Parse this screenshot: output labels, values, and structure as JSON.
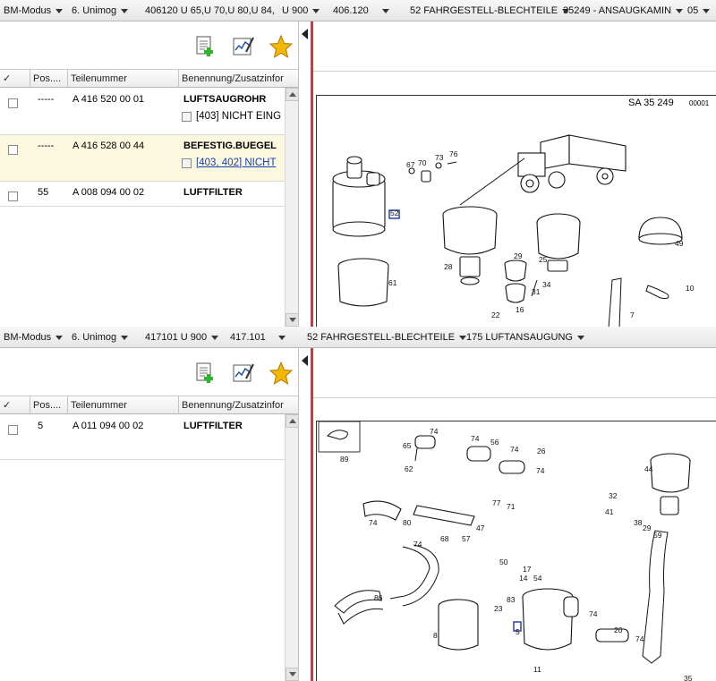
{
  "pane1": {
    "filters": [
      {
        "label": "BM-Modus"
      },
      {
        "label": "6. Unimog"
      },
      {
        "label": "406120 U 65,U 70,U 80,U 84,"
      },
      {
        "label": "U 900"
      },
      {
        "label": "406.120"
      },
      {
        "label": "52 FAHRGESTELL-BLECHTEILE"
      },
      {
        "label": "35249 - ANSAUGKAMIN"
      },
      {
        "label": "05"
      }
    ],
    "columns": [
      "✓",
      "Pos....",
      "Teilenummer",
      "Benennung/Zusatzinfor"
    ],
    "rows": [
      {
        "pos": "-----",
        "part": "A 416 520 00 01",
        "name": "LUFTSAUGROHR",
        "note": "[403] NICHT EING",
        "note_link": false,
        "highlight": false
      },
      {
        "pos": "-----",
        "part": "A 416 528 00 44",
        "name": "BEFESTIG.BUEGEL",
        "note": "[403, 402] NICHT",
        "note_link": true,
        "highlight": true
      },
      {
        "pos": "55",
        "part": "A 008 094 00 02",
        "name": "LUFTFILTER",
        "note": "",
        "note_link": false,
        "highlight": false
      }
    ],
    "sheet_code": "SA  35 249",
    "sheet_code_small": "00001",
    "callouts": [
      "67",
      "70",
      "73",
      "76",
      "52",
      "28",
      "29",
      "25",
      "49",
      "61",
      "31",
      "34",
      "10",
      "22",
      "16",
      "7"
    ]
  },
  "pane2": {
    "filters": [
      {
        "label": "BM-Modus"
      },
      {
        "label": "6. Unimog"
      },
      {
        "label": "417101 U 900"
      },
      {
        "label": "417.101"
      },
      {
        "label": "52 FAHRGESTELL-BLECHTEILE"
      },
      {
        "label": "175 LUFTANSAUGUNG"
      }
    ],
    "columns": [
      "✓",
      "Pos....",
      "Teilenummer",
      "Benennung/Zusatzinfor"
    ],
    "rows": [
      {
        "pos": "5",
        "part": "A 011 094 00 02",
        "name": "LUFTFILTER"
      }
    ],
    "callouts": [
      "89",
      "65",
      "74",
      "62",
      "74",
      "56",
      "74",
      "26",
      "74",
      "44",
      "32",
      "41",
      "38",
      "29",
      "59",
      "74",
      "80",
      "77",
      "71",
      "68",
      "57",
      "74",
      "47",
      "50",
      "17",
      "14",
      "54",
      "86",
      "83",
      "23",
      "8",
      "5",
      "74",
      "20",
      "74",
      "11",
      "35"
    ]
  },
  "colors": {
    "accent_red": "#d33333",
    "highlight_row": "#fbf8df",
    "link": "#1a3fb0",
    "add_icon_green": "#2db52d",
    "star_gold": "#f2b705"
  },
  "icons": [
    "add-document-icon",
    "edit-chart-icon",
    "favorite-star-icon"
  ]
}
